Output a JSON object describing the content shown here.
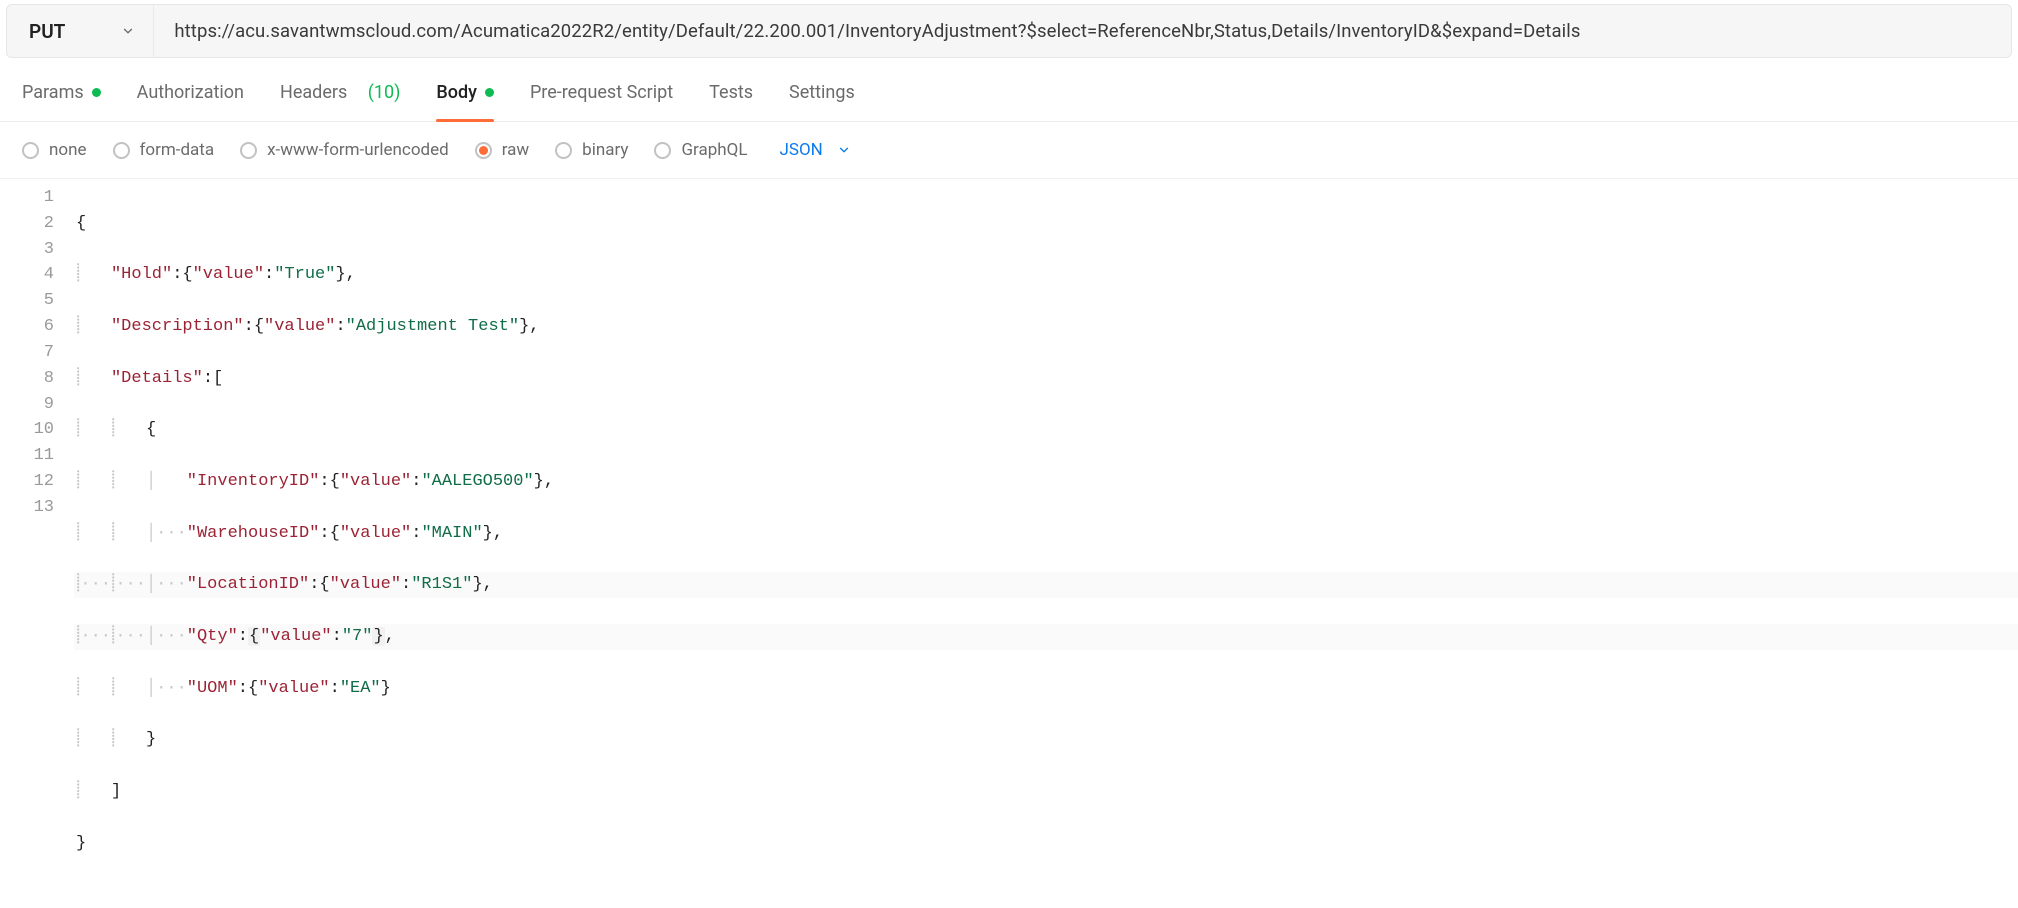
{
  "request": {
    "method": "PUT",
    "url": "https://acu.savantwmscloud.com/Acumatica2022R2/entity/Default/22.200.001/InventoryAdjustment?$select=ReferenceNbr,Status,Details/InventoryID&$expand=Details"
  },
  "tabs": {
    "params": "Params",
    "authorization": "Authorization",
    "headers_label": "Headers",
    "headers_count": "(10)",
    "body": "Body",
    "prerequest": "Pre-request Script",
    "tests": "Tests",
    "settings": "Settings"
  },
  "bodyTypes": {
    "none": "none",
    "formdata": "form-data",
    "xwww": "x-www-form-urlencoded",
    "raw": "raw",
    "binary": "binary",
    "graphql": "GraphQL",
    "contentType": "JSON"
  },
  "editor": {
    "lines": [
      "1",
      "2",
      "3",
      "4",
      "5",
      "6",
      "7",
      "8",
      "9",
      "10",
      "11",
      "12",
      "13"
    ],
    "keys": {
      "hold": "\"Hold\"",
      "value": "\"value\"",
      "description": "\"Description\"",
      "details": "\"Details\"",
      "inventoryId": "\"InventoryID\"",
      "warehouseId": "\"WarehouseID\"",
      "locationId": "\"LocationID\"",
      "qty": "\"Qty\"",
      "uom": "\"UOM\""
    },
    "vals": {
      "true": "\"True\"",
      "adjTest": "\"Adjustment Test\"",
      "aalego": "\"AALEGO500\"",
      "main": "\"MAIN\"",
      "r1s1": "\"R1S1\"",
      "seven": "\"7\"",
      "ea": "\"EA\""
    }
  }
}
